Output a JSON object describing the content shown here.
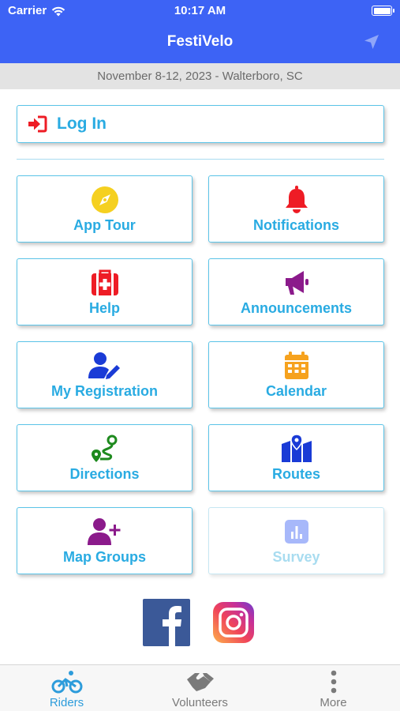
{
  "status": {
    "carrier": "Carrier",
    "time": "10:17 AM"
  },
  "header": {
    "title": "FestiVelo"
  },
  "event": {
    "date_location": "November 8-12, 2023 - Walterboro, SC"
  },
  "login": {
    "label": "Log In"
  },
  "tiles": [
    {
      "label": "App Tour",
      "icon": "compass-icon",
      "color": "#f5d020"
    },
    {
      "label": "Notifications",
      "icon": "bell-icon",
      "color": "#ee1c25"
    },
    {
      "label": "Help",
      "icon": "first-aid-kit-icon",
      "color": "#ee1c25"
    },
    {
      "label": "Announcements",
      "icon": "megaphone-icon",
      "color": "#8b1a8b"
    },
    {
      "label": "My Registration",
      "icon": "user-edit-icon",
      "color": "#1a3bd6"
    },
    {
      "label": "Calendar",
      "icon": "calendar-icon",
      "color": "#f6a21e"
    },
    {
      "label": "Directions",
      "icon": "route-icon",
      "color": "#1e8a1e"
    },
    {
      "label": "Routes",
      "icon": "map-icon",
      "color": "#1a3bd6"
    },
    {
      "label": "Map Groups",
      "icon": "user-plus-icon",
      "color": "#8b1a8b"
    },
    {
      "label": "Survey",
      "icon": "bar-chart-icon",
      "color": "#3d63f5",
      "disabled": true
    }
  ],
  "social": {
    "facebook_icon": "facebook-icon",
    "instagram_icon": "instagram-icon"
  },
  "tabbar": {
    "items": [
      {
        "label": "Riders",
        "icon": "bicycle-icon",
        "active": true
      },
      {
        "label": "Volunteers",
        "icon": "handshake-icon",
        "active": false
      },
      {
        "label": "More",
        "icon": "more-vertical-icon",
        "active": false
      }
    ]
  },
  "colors": {
    "header": "#3d63f5",
    "accent": "#29abe2",
    "tile_border": "#5bc4e8"
  }
}
